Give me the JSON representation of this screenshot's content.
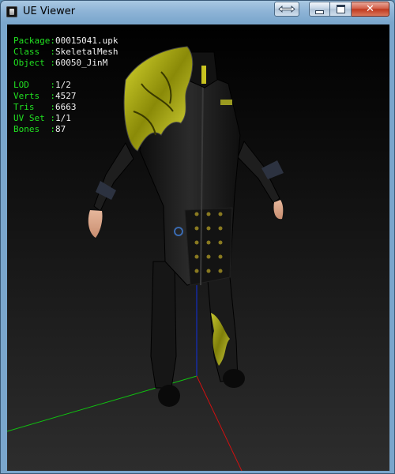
{
  "window": {
    "title": "UE Viewer",
    "buttons": {
      "restore_icon": "double-arrow-icon",
      "minimize_icon": "minimize-icon",
      "maximize_icon": "maximize-icon",
      "close_icon": "close-icon",
      "close_glyph": "✕"
    }
  },
  "viewport": {
    "background_top": "#000000",
    "background_bottom": "#2d2d2d",
    "text_key_color": "#21e021",
    "text_value_color": "#f0f0f0",
    "axes": {
      "x_color": "#d01010",
      "y_color": "#10c010",
      "z_color": "#1030e0"
    },
    "info": [
      {
        "key": "Package:",
        "value": "00015041.upk"
      },
      {
        "key": "Class  :",
        "value": "SkeletalMesh"
      },
      {
        "key": "Object :",
        "value": "60050_JinM"
      },
      {
        "key": "LOD    :",
        "value": "1/2"
      },
      {
        "key": "Verts  :",
        "value": "4527"
      },
      {
        "key": "Tris   :",
        "value": "6663"
      },
      {
        "key": "UV Set :",
        "value": "1/1"
      },
      {
        "key": "Bones  :",
        "value": "87"
      }
    ]
  }
}
